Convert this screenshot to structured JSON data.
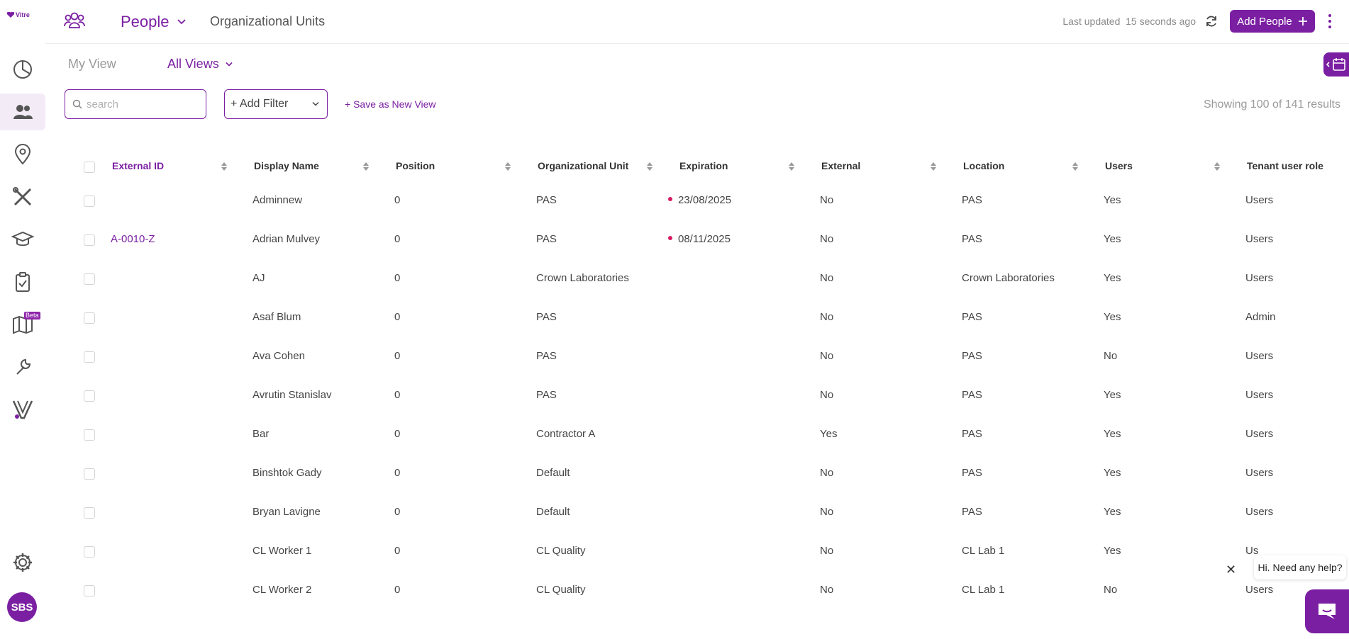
{
  "brand": {
    "logo_text": "Vitre",
    "accent": "#7b1fa2"
  },
  "sidebar": {
    "items": [
      {
        "icon": "dashboard-icon"
      },
      {
        "icon": "people-icon"
      },
      {
        "icon": "location-pin-icon"
      },
      {
        "icon": "tools-icon"
      },
      {
        "icon": "graduation-cap-icon"
      },
      {
        "icon": "clipboard-icon"
      },
      {
        "icon": "map-icon",
        "badge": "Beta"
      },
      {
        "icon": "wrench-icon"
      },
      {
        "icon": "v-logo-icon"
      },
      {
        "icon": "gear-icon"
      }
    ],
    "avatar": "SBS"
  },
  "header": {
    "title": "People",
    "secondary_tab": "Organizational Units",
    "last_updated_label": "Last updated",
    "last_updated_value": "15 seconds ago",
    "add_button": "Add People"
  },
  "views": {
    "my_view": "My View",
    "all_views": "All Views"
  },
  "filters": {
    "search_placeholder": "search",
    "add_filter": "+ Add Filter",
    "save_view": "+ Save as New View",
    "showing": "Showing 100 of 141 results"
  },
  "table": {
    "columns": [
      "External ID",
      "Display Name",
      "Position",
      "Organizational Unit",
      "Expiration",
      "External",
      "Location",
      "Users",
      "Tenant user role"
    ],
    "rows": [
      {
        "external_id": "",
        "display_name": "Adminnew",
        "position": "0",
        "org_unit": "PAS",
        "expiration": "23/08/2025",
        "external": "No",
        "location": "PAS",
        "users": "Yes",
        "role": "Users"
      },
      {
        "external_id": "A-0010-Z",
        "display_name": "Adrian Mulvey",
        "position": "0",
        "org_unit": "PAS",
        "expiration": "08/11/2025",
        "external": "No",
        "location": "PAS",
        "users": "Yes",
        "role": "Users"
      },
      {
        "external_id": "",
        "display_name": "AJ",
        "position": "0",
        "org_unit": "Crown Laboratories",
        "expiration": "",
        "external": "No",
        "location": "Crown Laboratories",
        "users": "Yes",
        "role": "Users"
      },
      {
        "external_id": "",
        "display_name": "Asaf Blum",
        "position": "0",
        "org_unit": "PAS",
        "expiration": "",
        "external": "No",
        "location": "PAS",
        "users": "Yes",
        "role": "Admin"
      },
      {
        "external_id": "",
        "display_name": "Ava Cohen",
        "position": "0",
        "org_unit": "PAS",
        "expiration": "",
        "external": "No",
        "location": "PAS",
        "users": "No",
        "role": "Users"
      },
      {
        "external_id": "",
        "display_name": "Avrutin Stanislav",
        "position": "0",
        "org_unit": "PAS",
        "expiration": "",
        "external": "No",
        "location": "PAS",
        "users": "Yes",
        "role": "Users"
      },
      {
        "external_id": "",
        "display_name": "Bar",
        "position": "0",
        "org_unit": "Contractor A",
        "expiration": "",
        "external": "Yes",
        "location": "PAS",
        "users": "Yes",
        "role": "Users"
      },
      {
        "external_id": "",
        "display_name": "Binshtok Gady",
        "position": "0",
        "org_unit": "Default",
        "expiration": "",
        "external": "No",
        "location": "PAS",
        "users": "Yes",
        "role": "Users"
      },
      {
        "external_id": "",
        "display_name": "Bryan Lavigne",
        "position": "0",
        "org_unit": "Default",
        "expiration": "",
        "external": "No",
        "location": "PAS",
        "users": "Yes",
        "role": "Users"
      },
      {
        "external_id": "",
        "display_name": "CL Worker 1",
        "position": "0",
        "org_unit": "CL Quality",
        "expiration": "",
        "external": "No",
        "location": "CL Lab 1",
        "users": "Yes",
        "role": "Us"
      },
      {
        "external_id": "",
        "display_name": "CL Worker 2",
        "position": "0",
        "org_unit": "CL Quality",
        "expiration": "",
        "external": "No",
        "location": "CL Lab 1",
        "users": "No",
        "role": "Users"
      }
    ]
  },
  "chat": {
    "message": "Hi. Need any help?"
  }
}
